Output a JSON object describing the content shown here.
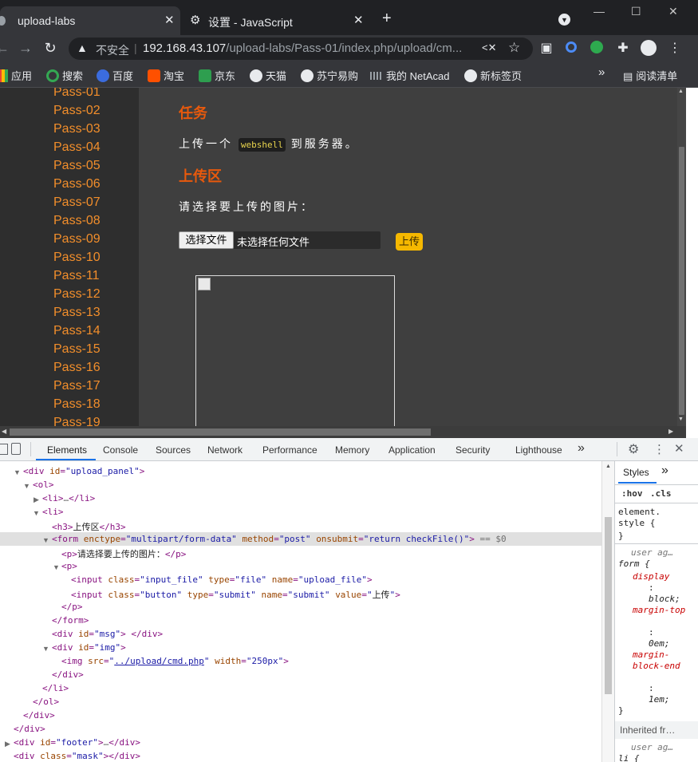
{
  "window": {
    "tabs": [
      {
        "title": "upload-labs",
        "active": true
      },
      {
        "title": "设置 - JavaScript",
        "active": false
      }
    ],
    "new_tab": "+",
    "controls": {
      "minimize": "—",
      "maximize": "☐",
      "close": "✕"
    }
  },
  "toolbar": {
    "security_label": "不安全",
    "url_host": "192.168.43.107",
    "url_path": "/upload-labs/Pass-01/index.php/upload/cm..."
  },
  "bookmarks": [
    "应用",
    "搜索",
    "百度",
    "淘宝",
    "京东",
    "天猫",
    "苏宁易购",
    "我的 NetAcad",
    "新标签页"
  ],
  "reading_list": "阅读清单",
  "bookmarks_more": "»",
  "sidebar": {
    "items": [
      "Pass-01",
      "Pass-02",
      "Pass-03",
      "Pass-04",
      "Pass-05",
      "Pass-06",
      "Pass-07",
      "Pass-08",
      "Pass-09",
      "Pass-10",
      "Pass-11",
      "Pass-12",
      "Pass-13",
      "Pass-14",
      "Pass-15",
      "Pass-16",
      "Pass-17",
      "Pass-18",
      "Pass-19"
    ]
  },
  "main": {
    "task_heading": "任务",
    "task_before": "上传一个",
    "task_code": "webshell",
    "task_after": "到服务器。",
    "upload_heading": "上传区",
    "select_prompt": "请选择要上传的图片：",
    "file_button": "选择文件",
    "file_status": "未选择任何文件",
    "submit_label": "上传"
  },
  "devtools": {
    "tabs": [
      "Elements",
      "Console",
      "Sources",
      "Network",
      "Performance",
      "Memory",
      "Application",
      "Security",
      "Lighthouse"
    ],
    "active_tab": "Elements",
    "more_tabs": "»",
    "styles_tabs": [
      "Styles",
      "»"
    ],
    "styles_filters": [
      ":hov",
      ".cls"
    ],
    "selected_marker": "== $0",
    "styles": {
      "element_style_1": "element.",
      "element_style_2": "style {",
      "brace_close": "}",
      "user_agent": "user ag…",
      "form_selector": "form {",
      "props": [
        {
          "name": "display",
          "value": "block;"
        },
        {
          "name": "margin-top",
          "value": "0em;"
        },
        {
          "name": "margin-block-end",
          "value": "1em;"
        }
      ],
      "inherited": "Inherited fr…",
      "user_agent_2": "user ag…",
      "li_selector": "li {"
    }
  },
  "colors": {
    "sidebar_link": "#f28e2b",
    "heading": "#e8590c",
    "submit_button": "#f5b800",
    "devtools_active": "#1a73e8"
  }
}
